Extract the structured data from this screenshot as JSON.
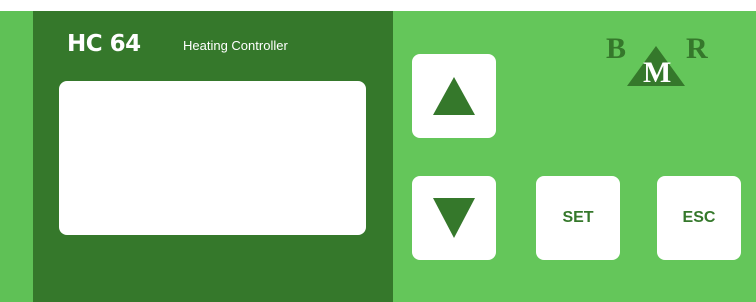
{
  "device": {
    "model": "HC 64",
    "subtitle": "Heating Controller"
  },
  "display": {
    "content": ""
  },
  "keys": {
    "up_icon": "triangle-up-icon",
    "down_icon": "triangle-down-icon",
    "set_label": "SET",
    "esc_label": "ESC"
  },
  "logo": {
    "letter_left": "B",
    "letter_center": "M",
    "letter_right": "R"
  },
  "colors": {
    "panel_green": "#64c65a",
    "dark_green": "#35782b",
    "button_white": "#ffffff"
  }
}
